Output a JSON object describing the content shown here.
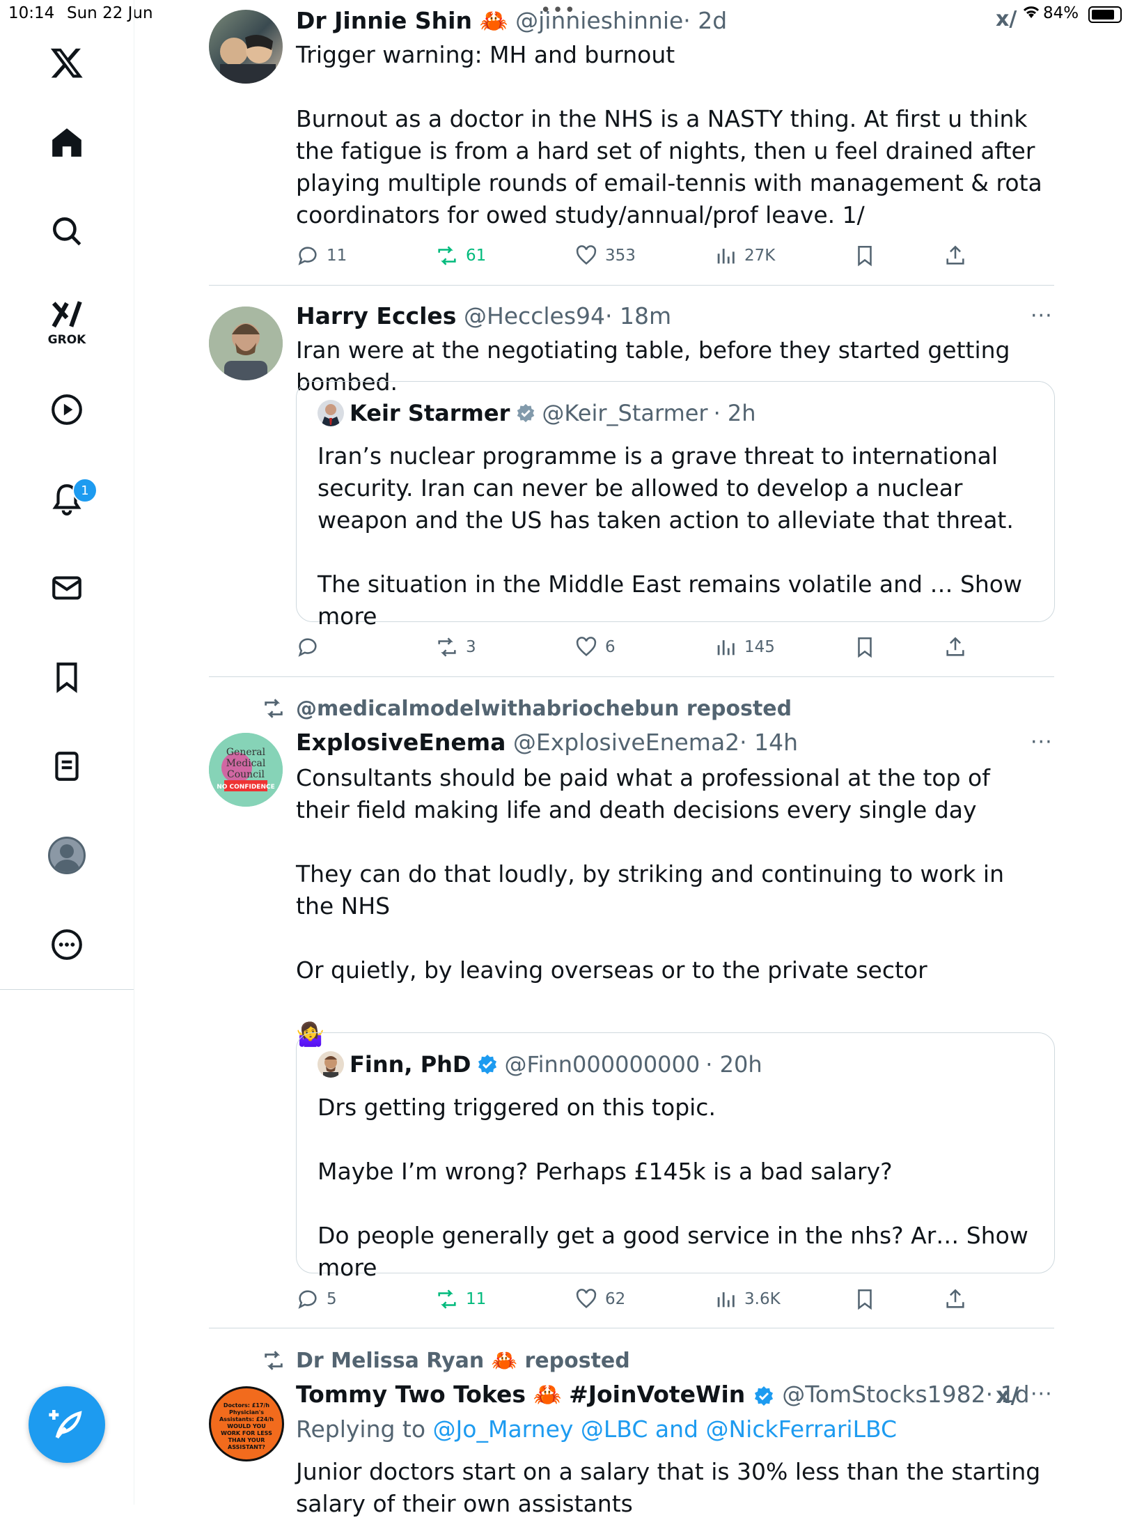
{
  "status_bar": {
    "time": "10:14",
    "date": "Sun 22 Jun",
    "battery": "84%"
  },
  "sidebar": {
    "grok_label": "GROK",
    "notifications_badge": "1"
  },
  "posts": [
    {
      "name": "Dr Jinnie Shin",
      "emoji": "🦀",
      "handle": "@jinnieshinnie",
      "time": "· 2d",
      "text": "Trigger warning: MH and burnout\n\nBurnout as a doctor in the NHS is a NASTY thing. At first u think the fatigue is from a hard set of nights, then u feel drained after playing multiple rounds of email-tennis with management & rota coordinators for owed study/annual/prof leave. 1/",
      "replies": "11",
      "reposts": "61",
      "likes": "353",
      "views": "27K"
    },
    {
      "name": "Harry Eccles",
      "handle": "@Heccles94",
      "time": "· 18m",
      "text": "Iran were at the negotiating table, before they started getting bombed.",
      "quote": {
        "name": "Keir Starmer",
        "handle": "@Keir_Starmer",
        "time": "· 2h",
        "text": "Iran’s nuclear programme is a grave threat to international security. Iran can never be allowed to develop a nuclear weapon and the US has taken action to alleviate that threat.\n\nThe situation in the Middle East remains volatile and … ",
        "show_more": "Show more"
      },
      "replies": "",
      "reposts": "3",
      "likes": "6",
      "views": "145"
    },
    {
      "repost_by": "@medicalmodelwithabriochebun reposted",
      "name": "ExplosiveEnema",
      "handle": "@ExplosiveEnema2",
      "time": "· 14h",
      "text": "Consultants should be paid what a professional at the top of their field making life and death decisions every single day\n\nThey can do that loudly, by striking and continuing to work in the NHS\n\nOr quietly, by leaving overseas or to the private sector\n\n🤷‍♀️",
      "quote": {
        "name": "Finn, PhD",
        "handle": "@Finn000000000",
        "time": "· 20h",
        "text": "Drs getting triggered on this topic.\n\nMaybe I’m wrong? Perhaps £145k is a bad salary?\n\nDo people generally get a good service in the nhs? Ar… ",
        "show_more": "Show more"
      },
      "replies": "5",
      "reposts": "11",
      "likes": "62",
      "views": "3.6K"
    },
    {
      "repost_by_name": "Dr Melissa Ryan",
      "repost_emoji": "🦀",
      "repost_suffix": "reposted",
      "name": "Tommy Two Tokes",
      "name_emoji": "🦀",
      "hashtag": "#JoinVoteWin",
      "handle": "@TomStocks1982",
      "time": "· 1d",
      "replying_prefix": "Replying to ",
      "replying_1": "@Jo_Marney",
      "replying_2": "@LBC",
      "replying_and": " and ",
      "replying_3": "@NickFerrariLBC",
      "text": "Junior doctors start on a salary that is 30% less than the starting salary of their own assistants",
      "avatar_text": "Doctors: £17/h Physician's Assistants: £24/h WOULD YOU WORK FOR LESS THAN YOUR ASSISTANT?"
    }
  ],
  "avatar3_text": "General Medical Council NO CONFIDENCE"
}
